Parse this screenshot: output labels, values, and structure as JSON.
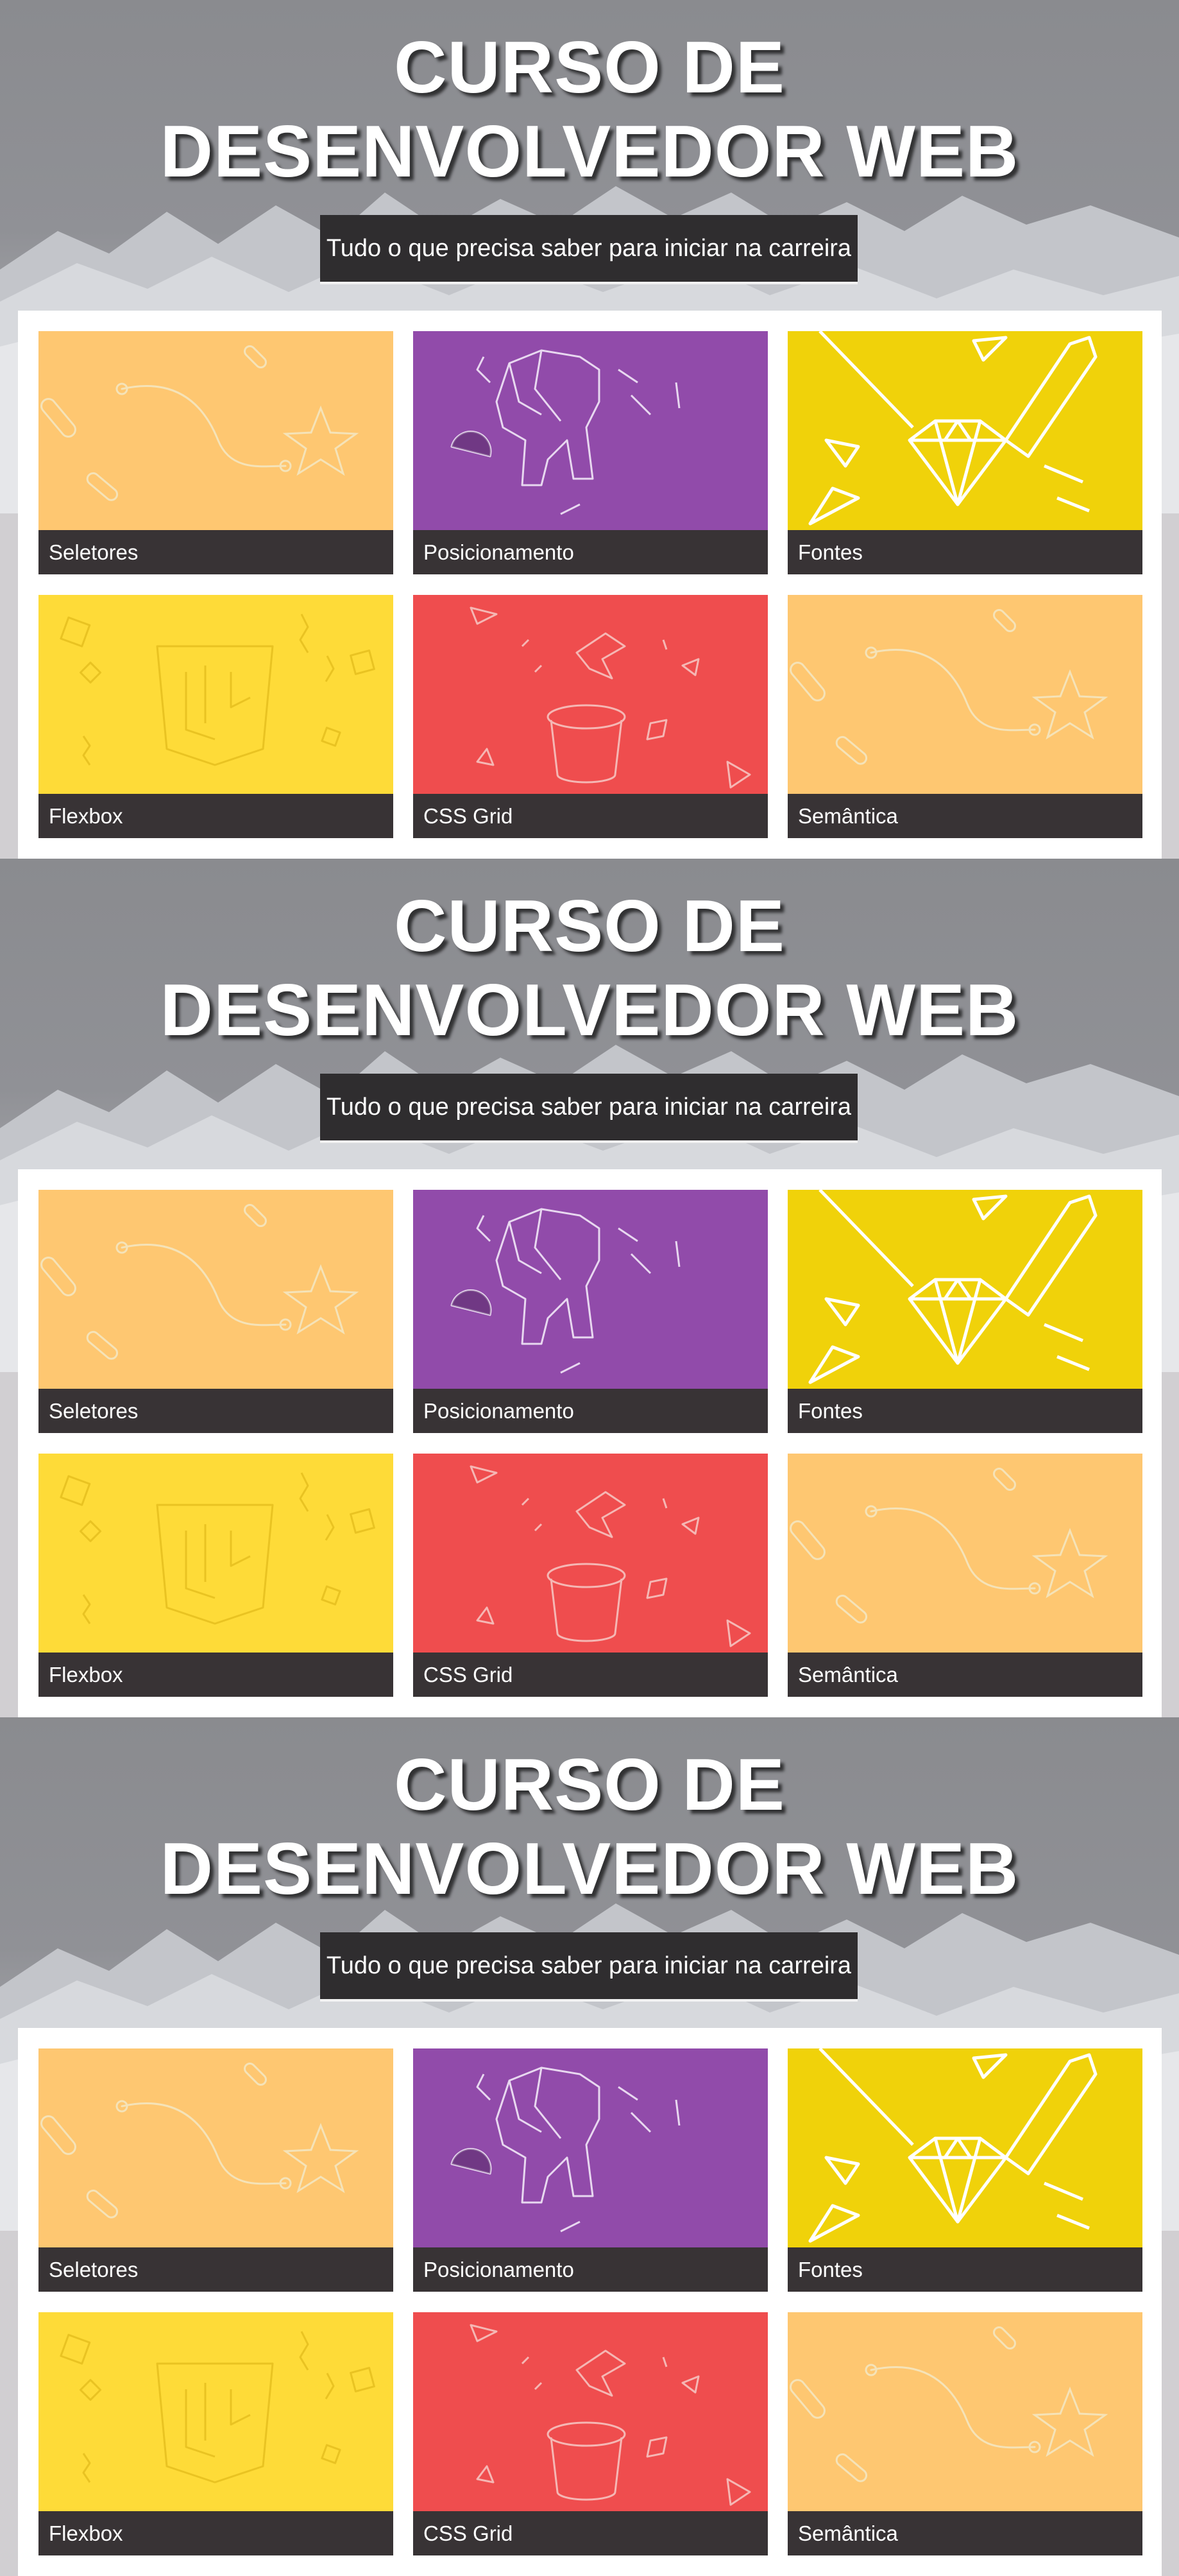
{
  "sections": [
    {
      "title_line1": "CURSO DE",
      "title_line2": "DESENVOLVEDOR WEB",
      "subtitle": "Tudo o que precisa saber para iniciar na carreira",
      "cards": [
        {
          "label": "Seletores",
          "color": "#fec771",
          "icon": "star-path-illustration"
        },
        {
          "label": "Posicionamento",
          "color": "#914baa",
          "icon": "origami-elephant-illustration"
        },
        {
          "label": "Fontes",
          "color": "#f0d20a",
          "icon": "diamond-pencil-illustration"
        },
        {
          "label": "Flexbox",
          "color": "#fedb38",
          "icon": "html5-shield-illustration"
        },
        {
          "label": "CSS Grid",
          "color": "#ef4d4e",
          "icon": "magic-hat-illustration"
        },
        {
          "label": "Semântica",
          "color": "#fec771",
          "icon": "star-path-illustration"
        }
      ]
    },
    {
      "title_line1": "CURSO DE",
      "title_line2": "DESENVOLVEDOR WEB",
      "subtitle": "Tudo o que precisa saber para iniciar na carreira",
      "cards": [
        {
          "label": "Seletores",
          "color": "#fec771",
          "icon": "star-path-illustration"
        },
        {
          "label": "Posicionamento",
          "color": "#914baa",
          "icon": "origami-elephant-illustration"
        },
        {
          "label": "Fontes",
          "color": "#f0d20a",
          "icon": "diamond-pencil-illustration"
        },
        {
          "label": "Flexbox",
          "color": "#fedb38",
          "icon": "html5-shield-illustration"
        },
        {
          "label": "CSS Grid",
          "color": "#ef4d4e",
          "icon": "magic-hat-illustration"
        },
        {
          "label": "Semântica",
          "color": "#fec771",
          "icon": "star-path-illustration"
        }
      ]
    },
    {
      "title_line1": "CURSO DE",
      "title_line2": "DESENVOLVEDOR WEB",
      "subtitle": "Tudo o que precisa saber para iniciar na carreira",
      "cards": [
        {
          "label": "Seletores",
          "color": "#fec771",
          "icon": "star-path-illustration"
        },
        {
          "label": "Posicionamento",
          "color": "#914baa",
          "icon": "origami-elephant-illustration"
        },
        {
          "label": "Fontes",
          "color": "#f0d20a",
          "icon": "diamond-pencil-illustration"
        },
        {
          "label": "Flexbox",
          "color": "#fedb38",
          "icon": "html5-shield-illustration"
        },
        {
          "label": "CSS Grid",
          "color": "#ef4d4e",
          "icon": "magic-hat-illustration"
        },
        {
          "label": "Semântica",
          "color": "#fec771",
          "icon": "star-path-illustration"
        }
      ]
    }
  ]
}
